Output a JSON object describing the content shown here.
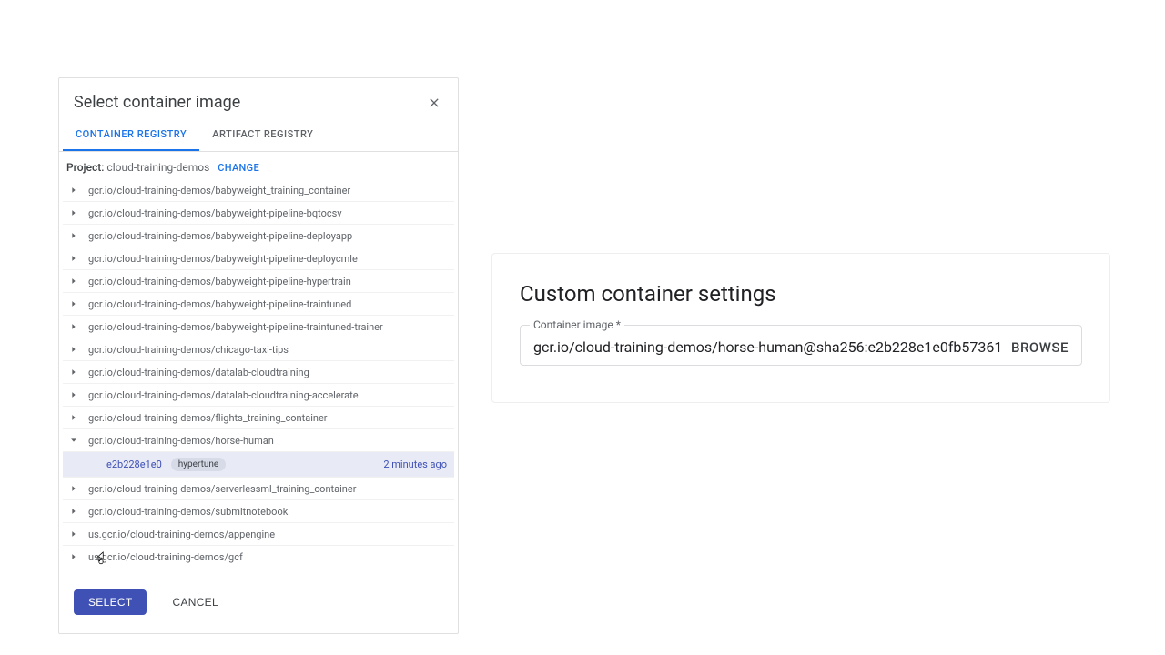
{
  "dialog": {
    "title": "Select container image",
    "tabs": [
      "CONTAINER REGISTRY",
      "ARTIFACT REGISTRY"
    ],
    "project_label": "Project:",
    "project_name": "cloud-training-demos",
    "change_label": "CHANGE",
    "repos": [
      {
        "path": "gcr.io/cloud-training-demos/babyweight_training_container",
        "expanded": false
      },
      {
        "path": "gcr.io/cloud-training-demos/babyweight-pipeline-bqtocsv",
        "expanded": false
      },
      {
        "path": "gcr.io/cloud-training-demos/babyweight-pipeline-deployapp",
        "expanded": false
      },
      {
        "path": "gcr.io/cloud-training-demos/babyweight-pipeline-deploycmle",
        "expanded": false
      },
      {
        "path": "gcr.io/cloud-training-demos/babyweight-pipeline-hypertrain",
        "expanded": false
      },
      {
        "path": "gcr.io/cloud-training-demos/babyweight-pipeline-traintuned",
        "expanded": false
      },
      {
        "path": "gcr.io/cloud-training-demos/babyweight-pipeline-traintuned-trainer",
        "expanded": false
      },
      {
        "path": "gcr.io/cloud-training-demos/chicago-taxi-tips",
        "expanded": false
      },
      {
        "path": "gcr.io/cloud-training-demos/datalab-cloudtraining",
        "expanded": false
      },
      {
        "path": "gcr.io/cloud-training-demos/datalab-cloudtraining-accelerate",
        "expanded": false
      },
      {
        "path": "gcr.io/cloud-training-demos/flights_training_container",
        "expanded": false
      },
      {
        "path": "gcr.io/cloud-training-demos/horse-human",
        "expanded": true,
        "child": {
          "hash": "e2b228e1e0",
          "tag": "hypertune",
          "time": "2 minutes ago"
        }
      },
      {
        "path": "gcr.io/cloud-training-demos/serverlessml_training_container",
        "expanded": false
      },
      {
        "path": "gcr.io/cloud-training-demos/submitnotebook",
        "expanded": false
      },
      {
        "path": "us.gcr.io/cloud-training-demos/appengine",
        "expanded": false
      },
      {
        "path": "us.gcr.io/cloud-training-demos/gcf",
        "expanded": false
      }
    ],
    "select_label": "SELECT",
    "cancel_label": "CANCEL"
  },
  "panel": {
    "title": "Custom container settings",
    "field_label": "Container image *",
    "field_value": "gcr.io/cloud-training-demos/horse-human@sha256:e2b228e1e0fb57361",
    "browse_label": "BROWSE"
  }
}
